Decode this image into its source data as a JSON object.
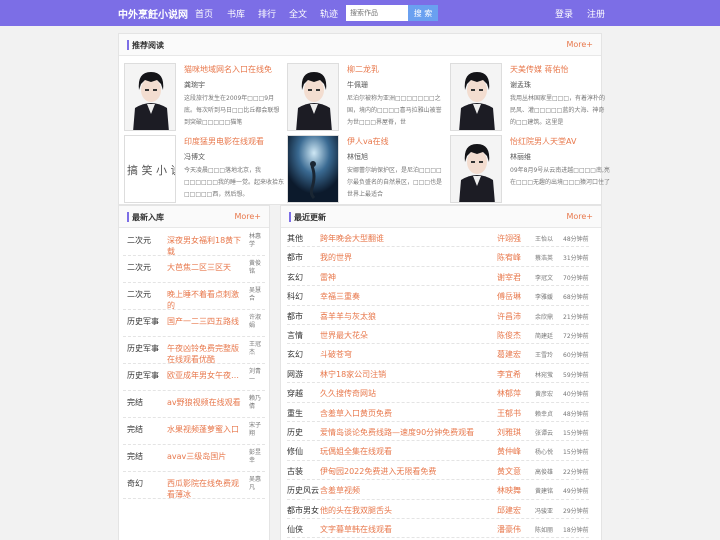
{
  "header": {
    "brand": "中外烹飪小说网",
    "nav": [
      "首页",
      "书库",
      "排行",
      "全文",
      "轨迹"
    ],
    "search_placeholder": "搜索作品",
    "search_button": "搜 索",
    "login": "登录",
    "register": "注册"
  },
  "recommend": {
    "title": "推荐阅读",
    "more": "More+",
    "items": [
      {
        "title": "猫咪地域网名入口在线免",
        "author": "龚琬宇",
        "desc": "这段旅行发生在2009年□□□9月底。每次听到马日□□比丘都会联想到突破□□□□□猫笔",
        "cover": "anime"
      },
      {
        "title": "柳二龙乳",
        "author": "牛佩珊",
        "desc": "尼泊尔被称为亚洲□□□□□□□之国，境内的□□□□喜马拉雅山被誉为世□□□界屋脊，世",
        "cover": "anime"
      },
      {
        "title": "天美传媒 蒋佑怡",
        "author": "谢孟珠",
        "desc": "我用丛林国家里□□□，有着淳朴的民风、灌□□□□□蓝的大海、神奇的□□建筑。这里是",
        "cover": "anime"
      },
      {
        "title": "印度猛男电影在线观看",
        "author": "冯博文",
        "desc": "今天凌晨□□□落地北京，我□□□□□□我的睡一觉。起来收拾东□□□□□西，然后想。",
        "cover": "text"
      },
      {
        "title": "伊人va在线",
        "author": "林恒旭",
        "desc": "安娜蕾尔纳保护区，是尼泊□□□□尔最负盛名的自然景区，□□□也是世界上最适合",
        "cover": "sea"
      },
      {
        "title": "怡红院男人天堂AV",
        "author": "林丽维",
        "desc": "09年8月9号从云南进越□□□□南,亮在□□□无趣的出境□□□猿河口住了",
        "cover": "anime"
      }
    ]
  },
  "newest": {
    "title": "最新入库",
    "more": "More+",
    "items": [
      {
        "cat": "二次元",
        "title": "深夜男女福利18黄下载",
        "author": "林惠学"
      },
      {
        "cat": "二次元",
        "title": "大芭焦二区三区天",
        "author": "黄俊铭"
      },
      {
        "cat": "二次元",
        "title": "晚上睡不着看点刺激的",
        "author": "吴慧合"
      },
      {
        "cat": "历史军事",
        "title": "国产一二三四五路线",
        "author": "许淑娟"
      },
      {
        "cat": "历史军事",
        "title": "午夜凶铃免费完整版在线观看优酷",
        "author": "王冠杰"
      },
      {
        "cat": "历史军事",
        "title": "欧亚成年男女午夜…",
        "author": "刘青一"
      },
      {
        "cat": "完结",
        "title": "av野狼视频在线观看",
        "author": "赖乃倩"
      },
      {
        "cat": "完结",
        "title": "水果视频蓬萝蜜入口",
        "author": "宋子翔"
      },
      {
        "cat": "完结",
        "title": "avav三级岛国片",
        "author": "彭昱幸"
      },
      {
        "cat": "奇幻",
        "title": "西瓜影院在线免费观看薄冰",
        "author": "吴惠凡"
      }
    ]
  },
  "updates": {
    "title": "最近更新",
    "more": "More+",
    "items": [
      {
        "cat": "其他",
        "title": "跨年晚会大型翻谁",
        "author": "许翊强",
        "writer": "王怡以",
        "time": "48分钟前"
      },
      {
        "cat": "都市",
        "title": "我的世界",
        "author": "陈宥峰",
        "writer": "蔡浩英",
        "time": "31分钟前"
      },
      {
        "cat": "玄幻",
        "title": "雷神",
        "author": "谢宰君",
        "writer": "李冠文",
        "time": "70分钟前"
      },
      {
        "cat": "科幻",
        "title": "幸福三重奏",
        "author": "傅岳琳",
        "writer": "李雅媛",
        "time": "68分钟前"
      },
      {
        "cat": "都市",
        "title": "喜羊羊与灰太狼",
        "author": "许昌沛",
        "writer": "余欣鼎",
        "time": "21分钟前"
      },
      {
        "cat": "言情",
        "title": "世界最大花朵",
        "author": "陈俊杰",
        "writer": "简建廷",
        "time": "72分钟前"
      },
      {
        "cat": "玄幻",
        "title": "斗破苍穹",
        "author": "葛建宏",
        "writer": "王雪玲",
        "time": "60分钟前"
      },
      {
        "cat": "网游",
        "title": "林宁18家公司注销",
        "author": "李宜希",
        "writer": "林宛萤",
        "time": "59分钟前"
      },
      {
        "cat": "穿越",
        "title": "久久搜传奇网站",
        "author": "林郁萍",
        "writer": "黄彦宏",
        "time": "40分钟前"
      },
      {
        "cat": "重生",
        "title": "含羞草入口黄页免费",
        "author": "王郁书",
        "writer": "赖幸贞",
        "time": "48分钟前"
      },
      {
        "cat": "历史",
        "title": "爱情岛谈论免费线路—速度90分钟免费观看",
        "author": "刘雅琪",
        "writer": "张谭云",
        "time": "15分钟前"
      },
      {
        "cat": "修仙",
        "title": "玩偶姐全集在线观看",
        "author": "黄仲峰",
        "writer": "杨心悦",
        "time": "15分钟前"
      },
      {
        "cat": "古装",
        "title": "伊甸园2022免费进入无限看免费",
        "author": "黄文意",
        "writer": "高俊雄",
        "time": "22分钟前"
      },
      {
        "cat": "历史风云",
        "title": "含羞草视频",
        "author": "林映舞",
        "writer": "黄建铭",
        "time": "49分钟前"
      },
      {
        "cat": "都市男女",
        "title": "他的头在我双腿舌头",
        "author": "邱建宏",
        "writer": "冯骏亚",
        "time": "29分钟前"
      },
      {
        "cat": "仙侠",
        "title": "文字暮草韩在线观看",
        "author": "潘豪伟",
        "writer": "陈如丽",
        "time": "18分钟前"
      }
    ]
  }
}
